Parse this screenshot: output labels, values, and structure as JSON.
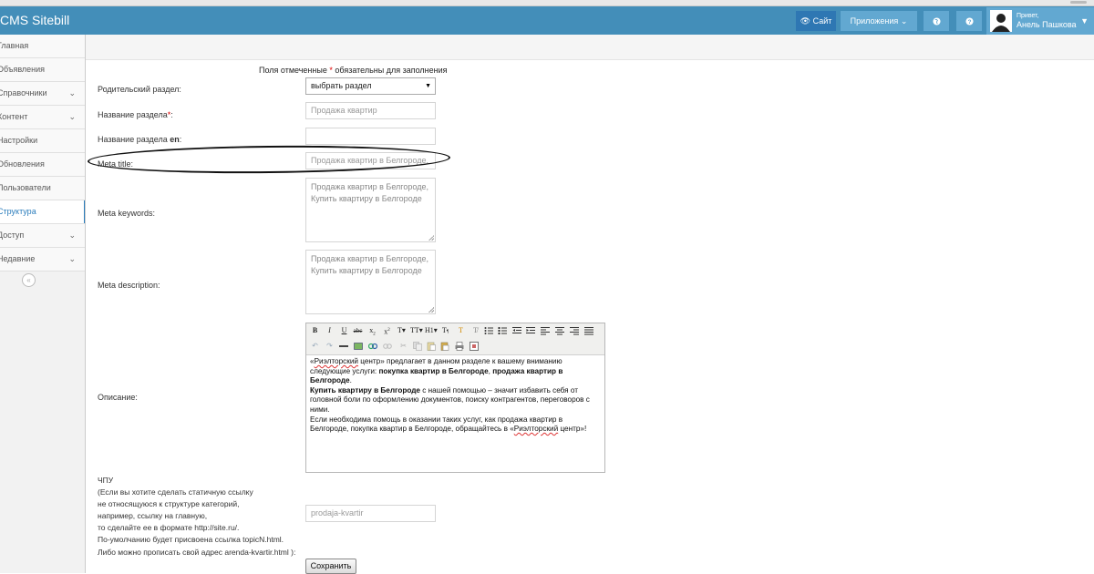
{
  "app": {
    "title": "CMS Sitebill"
  },
  "navbar": {
    "site_label": "Сайт",
    "apps_label": "Приложения",
    "user_greeting": "Привет,",
    "user_name": "Анель Пашкова"
  },
  "sidebar": {
    "items": [
      {
        "label": "Главная",
        "has_children": false,
        "active": false
      },
      {
        "label": "Объявления",
        "has_children": false,
        "active": false
      },
      {
        "label": "Справочники",
        "has_children": true,
        "active": false
      },
      {
        "label": "Контент",
        "has_children": true,
        "active": false
      },
      {
        "label": "Настройки",
        "has_children": false,
        "active": false
      },
      {
        "label": "Обновления",
        "has_children": false,
        "active": false
      },
      {
        "label": "Пользователи",
        "has_children": false,
        "active": false
      },
      {
        "label": "Структура",
        "has_children": false,
        "active": true
      },
      {
        "label": "Доступ",
        "has_children": true,
        "active": false
      },
      {
        "label": "Недавние",
        "has_children": true,
        "active": false
      }
    ],
    "collapse_symbol": "«"
  },
  "form": {
    "required_note_before": "Поля отмеченные ",
    "required_star": "*",
    "required_note_after": " обязательны для заполнения",
    "parent_label": "Родительский раздел:",
    "parent_value": "выбрать раздел",
    "name_label": "Название раздела",
    "name_colon": ":",
    "name_value": "Продажа квартир",
    "name_en_label_pre": "Название раздела ",
    "name_en_label_bold": "en",
    "name_en_label_post": ":",
    "name_en_value": "",
    "meta_title_label": "Meta title:",
    "meta_title_value": "Продажа квартир в Белгороде,",
    "meta_keywords_label": "Meta keywords:",
    "meta_keywords_value": "Продажа квартир в Белгороде, Купить квартиру в Белгороде",
    "meta_description_label": "Meta description:",
    "meta_description_value": "Продажа квартир в Белгороде, Купить квартиру в Белгороде",
    "description_label": "Описание:",
    "editor": {
      "p1_quote_open": "«",
      "p1_spell": "Риэлторский",
      "p1_text": " центр» предлагает в данном разделе к вашему вниманию следующие услуги: ",
      "p1_bold1": "покупка квартир в Белгороде",
      "p1_sep": ", ",
      "p1_bold2": "продажа квартир в Белгороде",
      "p1_end": ".",
      "p2_bold": "Купить квартиру в Белгороде",
      "p2_text": " с нашей помощью – значит избавить себя от головной боли по оформлению документов, поиску контрагентов, переговоров с ними.",
      "p3_text": "Если необходима помощь в оказании таких услуг, как продажа квартир в Белгороде, покупка квартир в Белгороде, обращайтесь в «",
      "p3_spell": "Риэлторский",
      "p3_end": " центр»!"
    },
    "chpu_lines": [
      "ЧПУ",
      "(Если вы хотите сделать статичную ссылку",
      "не относящуюся к структуре категорий,",
      "например, ссылку на главную,",
      "то сделайте ее в формате http://site.ru/.",
      "По-умолчанию будет присвоена ссылка topicN.html.",
      "Либо можно прописать свой адрес arenda-kvartir.html ):"
    ],
    "chpu_value": "prodaja-kvartir",
    "save_label": "Сохранить"
  }
}
